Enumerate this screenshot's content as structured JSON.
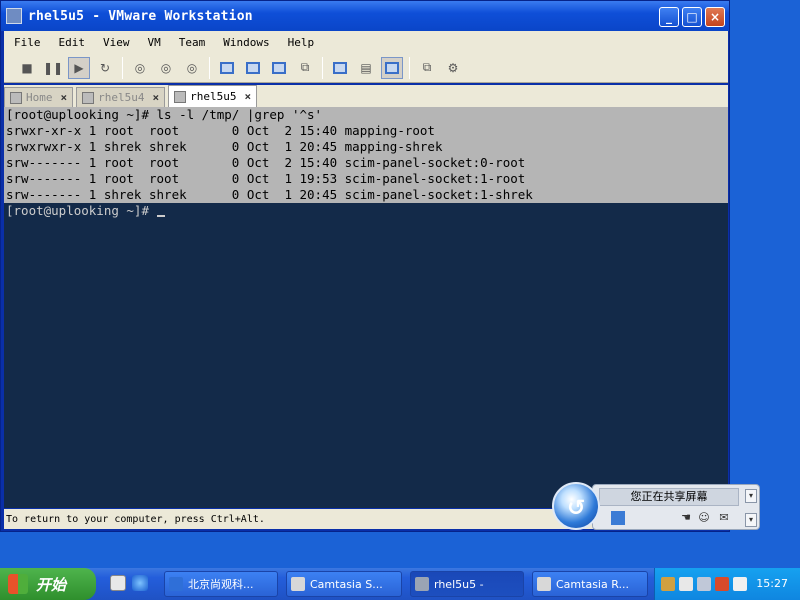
{
  "window": {
    "title": "rhel5u5 - VMware Workstation",
    "controls": {
      "minimize": "_",
      "maximize": "□",
      "close": "×"
    }
  },
  "menu": [
    "File",
    "Edit",
    "View",
    "VM",
    "Team",
    "Windows",
    "Help"
  ],
  "toolbar": {
    "icons": [
      "power-off-icon",
      "pause-icon",
      "play-icon",
      "reset-icon",
      "snapshot-icon",
      "revert-snapshot-icon",
      "snapshot-manager-icon",
      "console-view-icon",
      "full-screen-icon",
      "quick-switch-icon",
      "summary-view-icon",
      "appliance-view-icon",
      "console-icon",
      "clone-icon",
      "settings-icon"
    ]
  },
  "tabs": [
    {
      "label": "Home",
      "active": false
    },
    {
      "label": "rhel5u4",
      "active": false
    },
    {
      "label": "rhel5u5",
      "active": true
    }
  ],
  "terminal": {
    "selected_lines": [
      "[root@uplooking ~]# ls -l /tmp/ |grep '^s'",
      "srwxr-xr-x 1 root  root       0 Oct  2 15:40 mapping-root",
      "srwxrwxr-x 1 shrek shrek      0 Oct  1 20:45 mapping-shrek",
      "srw------- 1 root  root       0 Oct  2 15:40 scim-panel-socket:0-root",
      "srw------- 1 root  root       0 Oct  1 19:53 scim-panel-socket:1-root",
      "srw------- 1 shrek shrek      0 Oct  1 20:45 scim-panel-socket:1-shrek"
    ],
    "prompt": "[root@uplooking ~]# ",
    "colors": {
      "background": "#132a49",
      "selection": "#b5b5b5",
      "text": "#cccccc"
    }
  },
  "status_bar": {
    "text": "To return to your computer, press Ctrl+Alt."
  },
  "sharing_widget": {
    "label": "您正在共享屏幕"
  },
  "taskbar": {
    "start_label": "开始",
    "tasks": [
      {
        "label": "北京尚观科...",
        "active": false
      },
      {
        "label": "Camtasia S...",
        "active": false
      },
      {
        "label": "rhel5u5 -",
        "active": true
      },
      {
        "label": "Camtasia R...",
        "active": false
      }
    ],
    "clock": "15:27"
  }
}
